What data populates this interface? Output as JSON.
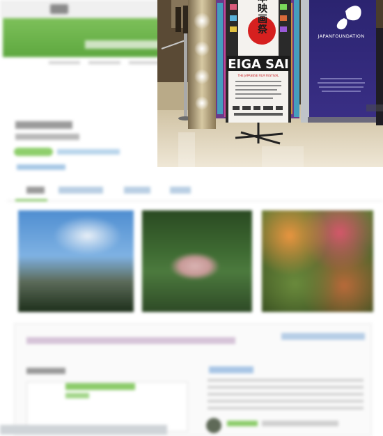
{
  "photo": {
    "kanji": "日本映画祭",
    "banner_title": "EIGA SAI",
    "banner_subtitle": "THE JAPANESE FILM FESTIVAL",
    "foundation_name": "JAPANFOUNDATION",
    "colors": {
      "festival_red": "#d6201f",
      "foundation_purple": "#2b2470",
      "floor": "#e8dfcf"
    }
  },
  "icons": {
    "foundation_logo": "butterfly-logo-icon",
    "hinomaru": "red-circle-seal-icon"
  }
}
